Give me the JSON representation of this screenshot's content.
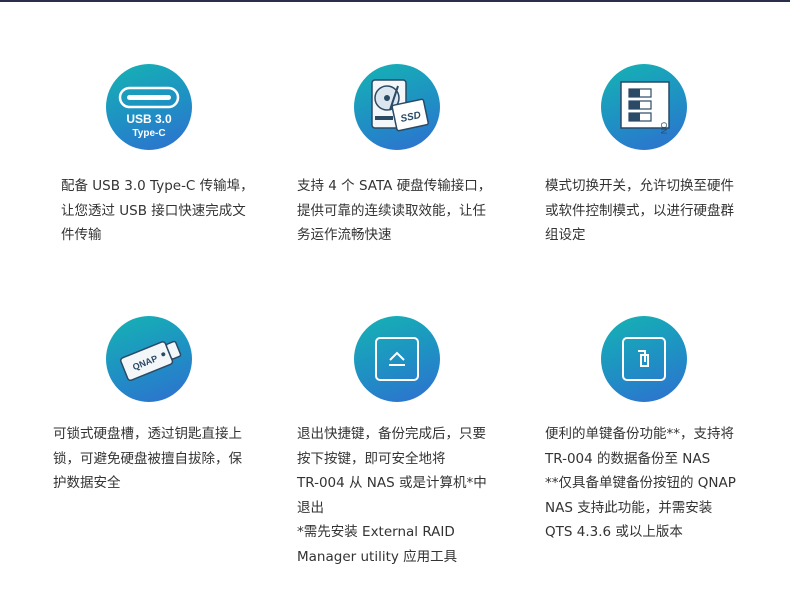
{
  "features": [
    {
      "icon": "usb-c-icon",
      "icon_text": {
        "line1": "USB 3.0",
        "line2": "Type-C"
      },
      "lines": [
        "配备 USB 3.0 Type-C 传输埠，",
        "让您透过 USB 接口快速完成文",
        "件传输"
      ]
    },
    {
      "icon": "hdd-ssd-icon",
      "icon_text": {
        "line1": "SSD"
      },
      "lines": [
        "支持 4 个 SATA 硬盘传输接口，",
        "提供可靠的连续读取效能，让任",
        "务运作流畅快速"
      ]
    },
    {
      "icon": "dip-switch-icon",
      "icon_text": {
        "on": "ON"
      },
      "lines": [
        "模式切换开关，允许切换至硬件",
        "或软件控制模式，以进行硬盘群",
        "组设定"
      ]
    },
    {
      "icon": "drive-tray-lock-icon",
      "icon_text": {
        "brand": "QNAP"
      },
      "lines": [
        "可锁式硬盘槽，透过钥匙直接上",
        "锁，可避免硬盘被擅自拔除，保",
        "护数据安全"
      ]
    },
    {
      "icon": "eject-button-icon",
      "lines": [
        "退出快捷键，备份完成后，只要",
        "按下按键，即可安全地将",
        "TR-004 从 NAS 或是计算机*中",
        "退出",
        "*需先安装 External RAID",
        "Manager utility 应用工具"
      ]
    },
    {
      "icon": "copy-button-icon",
      "lines": [
        "便利的单键备份功能**，支持将",
        "TR-004 的数据备份至 NAS",
        "**仅具备单键备份按钮的 QNAP",
        "NAS 支持此功能，并需安装",
        "QTS 4.3.6 或以上版本"
      ]
    }
  ]
}
